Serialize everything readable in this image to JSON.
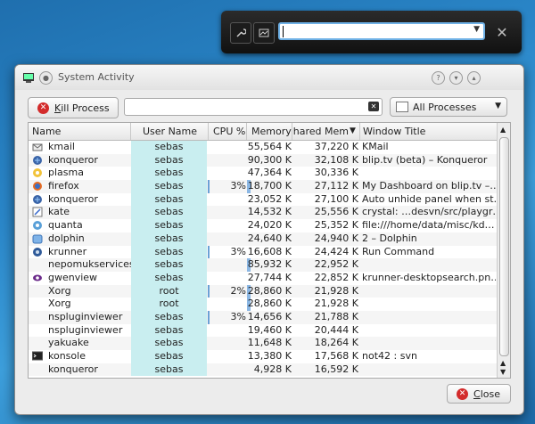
{
  "krunner": {
    "wrench_icon": "wrench-icon",
    "activity_icon": "monitor-icon",
    "input_value": "",
    "close_icon": "close-icon"
  },
  "window": {
    "title": "System Activity",
    "kill_button": {
      "prefix": "",
      "hotkey": "K",
      "rest": "ill Process"
    },
    "search": {
      "value": ""
    },
    "filter": {
      "selected": "All Processes"
    },
    "close_button": {
      "hotkey": "C",
      "rest": "lose"
    }
  },
  "table": {
    "columns": [
      "Name",
      "User Name",
      "CPU %",
      "Memory",
      "Shared Mem",
      "Window Title"
    ],
    "rows": [
      {
        "icon": "kmail",
        "name": "kmail",
        "user": "sebas",
        "cpu": "",
        "mem": "55,564 K",
        "shared": "37,220 K",
        "title": "KMail",
        "mem_frac": 0
      },
      {
        "icon": "konqueror",
        "name": "konqueror",
        "user": "sebas",
        "cpu": "",
        "mem": "90,300 K",
        "shared": "32,108 K",
        "title": "blip.tv (beta) – Konqueror",
        "mem_frac": 0
      },
      {
        "icon": "plasma",
        "name": "plasma",
        "user": "sebas",
        "cpu": "",
        "mem": "47,364 K",
        "shared": "30,336 K",
        "title": "",
        "mem_frac": 0
      },
      {
        "icon": "firefox",
        "name": "firefox",
        "user": "sebas",
        "cpu": "3%",
        "mem": "18,700 K",
        "shared": "27,112 K",
        "title": "My Dashboard on blip.tv –…",
        "mem_frac": 1
      },
      {
        "icon": "konqueror",
        "name": "konqueror",
        "user": "sebas",
        "cpu": "",
        "mem": "23,052 K",
        "shared": "27,100 K",
        "title": "Auto unhide panel when st…",
        "mem_frac": 0
      },
      {
        "icon": "kate",
        "name": "kate",
        "user": "sebas",
        "cpu": "",
        "mem": "14,532 K",
        "shared": "25,556 K",
        "title": "crystal: …desvn/src/playgr…",
        "mem_frac": 0
      },
      {
        "icon": "quanta",
        "name": "quanta",
        "user": "sebas",
        "cpu": "",
        "mem": "24,020 K",
        "shared": "25,352 K",
        "title": "file:///home/data/misc/kd…",
        "mem_frac": 0
      },
      {
        "icon": "dolphin",
        "name": "dolphin",
        "user": "sebas",
        "cpu": "",
        "mem": "24,640 K",
        "shared": "24,940 K",
        "title": "2 – Dolphin",
        "mem_frac": 0
      },
      {
        "icon": "krunner",
        "name": "krunner",
        "user": "sebas",
        "cpu": "3%",
        "mem": "16,608 K",
        "shared": "24,424 K",
        "title": "Run Command",
        "mem_frac": 0
      },
      {
        "icon": "",
        "name": "nepomukservices",
        "user": "sebas",
        "cpu": "",
        "mem": "85,932 K",
        "shared": "22,952 K",
        "title": "",
        "mem_frac": 1
      },
      {
        "icon": "gwenview",
        "name": "gwenview",
        "user": "sebas",
        "cpu": "",
        "mem": "27,744 K",
        "shared": "22,852 K",
        "title": "krunner-desktopsearch.pn…",
        "mem_frac": 0
      },
      {
        "icon": "",
        "name": "Xorg",
        "user": "root",
        "cpu": "2%",
        "mem": "28,860 K",
        "shared": "21,928 K",
        "title": "",
        "mem_frac": 1
      },
      {
        "icon": "",
        "name": "Xorg",
        "user": "root",
        "cpu": "",
        "mem": "28,860 K",
        "shared": "21,928 K",
        "title": "",
        "mem_frac": 1
      },
      {
        "icon": "",
        "name": "nspluginviewer",
        "user": "sebas",
        "cpu": "3%",
        "mem": "14,656 K",
        "shared": "21,788 K",
        "title": "",
        "mem_frac": 0
      },
      {
        "icon": "",
        "name": "nspluginviewer",
        "user": "sebas",
        "cpu": "",
        "mem": "19,460 K",
        "shared": "20,444 K",
        "title": "",
        "mem_frac": 0
      },
      {
        "icon": "",
        "name": "yakuake",
        "user": "sebas",
        "cpu": "",
        "mem": "11,648 K",
        "shared": "18,264 K",
        "title": "",
        "mem_frac": 0
      },
      {
        "icon": "konsole",
        "name": "konsole",
        "user": "sebas",
        "cpu": "",
        "mem": "13,380 K",
        "shared": "17,568 K",
        "title": "not42 : svn",
        "mem_frac": 0
      },
      {
        "icon": "",
        "name": "konqueror",
        "user": "sebas",
        "cpu": "",
        "mem": "4,928 K",
        "shared": "16,592 K",
        "title": "",
        "mem_frac": 0
      }
    ]
  },
  "colors": {
    "accent": "#6fb1e6",
    "user_col": "#c9eef0",
    "kill": "#d32b2b"
  }
}
